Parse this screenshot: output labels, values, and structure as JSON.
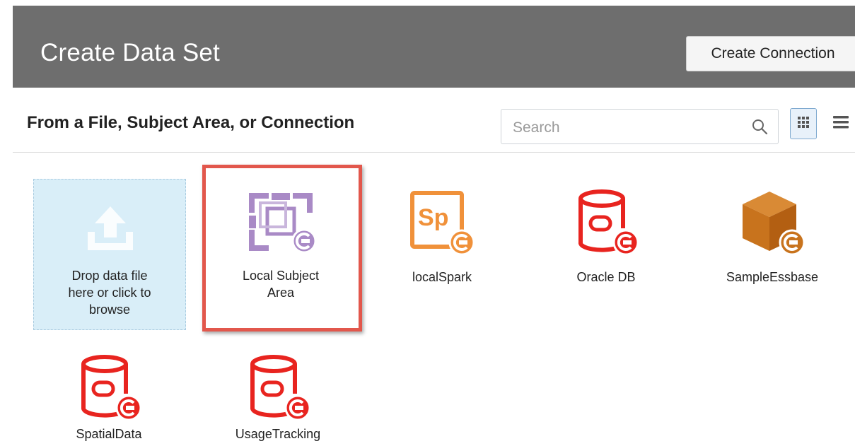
{
  "header": {
    "title": "Create Data Set",
    "create_connection_label": "Create Connection"
  },
  "section": {
    "title": "From a File, Subject Area, or Connection"
  },
  "search": {
    "placeholder": "Search",
    "value": ""
  },
  "view_toggle": {
    "grid_icon": "grid-view-icon",
    "list_icon": "list-view-icon",
    "selected": "grid"
  },
  "drop_zone": {
    "label_line1": "Drop data file",
    "label_line2": "here or click to",
    "label_line3": "browse",
    "icon": "upload-icon"
  },
  "sources": [
    {
      "label_line1": "Local Subject",
      "label_line2": "Area",
      "icon": "subject-area-icon",
      "color": "#a98ac6",
      "selected": true
    },
    {
      "label_line1": "localSpark",
      "label_line2": "",
      "icon": "spark-icon",
      "color": "#f0913a",
      "selected": false
    },
    {
      "label_line1": "Oracle DB",
      "label_line2": "",
      "icon": "database-icon",
      "color": "#e8241f",
      "selected": false
    },
    {
      "label_line1": "SampleEssbase",
      "label_line2": "",
      "icon": "essbase-cube-icon",
      "color": "#c8731d",
      "selected": false
    },
    {
      "label_line1": "SpatialData",
      "label_line2": "",
      "icon": "database-icon",
      "color": "#e8241f",
      "selected": false
    },
    {
      "label_line1": "UsageTracking",
      "label_line2": "",
      "icon": "database-icon",
      "color": "#e8241f",
      "selected": false
    }
  ],
  "colors": {
    "header_bg": "#6e6e6e",
    "selection_border": "#e2574c",
    "drop_zone_bg": "#d9eef8"
  }
}
